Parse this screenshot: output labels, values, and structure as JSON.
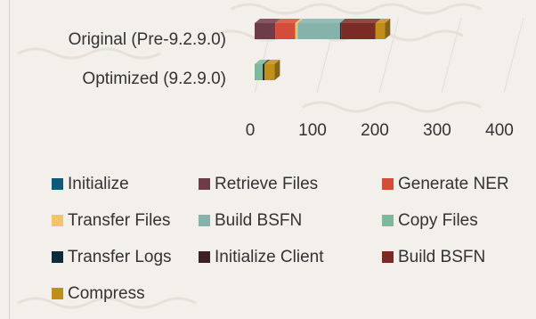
{
  "chart_data": {
    "type": "bar",
    "orientation": "horizontal",
    "stacked": true,
    "style": "3d",
    "categories": [
      "Original (Pre-9.2.9.0)",
      "Optimized (9.2.9.0)"
    ],
    "xlim": [
      0,
      400
    ],
    "xticks": [
      0,
      100,
      200,
      300,
      400
    ],
    "grid": false,
    "legend_position": "bottom",
    "series": [
      {
        "name": "Initialize",
        "color": "#0e5a78",
        "values": [
          0,
          0
        ]
      },
      {
        "name": "Retrieve Files",
        "color": "#6e3b49",
        "values": [
          33,
          0
        ]
      },
      {
        "name": "Generate NER",
        "color": "#d54c3a",
        "values": [
          32,
          0
        ]
      },
      {
        "name": "Transfer Files",
        "color": "#f2c46a",
        "values": [
          4,
          0
        ]
      },
      {
        "name": "Build BSFN",
        "color": "#86b2ac",
        "values": [
          68,
          0
        ]
      },
      {
        "name": "Copy Files",
        "color": "#7fb79a",
        "values": [
          0,
          13
        ]
      },
      {
        "name": "Transfer Logs",
        "color": "#0c2c3b",
        "values": [
          2,
          3
        ]
      },
      {
        "name": "Initialize Client",
        "color": "#3d1f26",
        "values": [
          0,
          0
        ]
      },
      {
        "name": "Build BSFN",
        "color": "#7a2b25",
        "values": [
          55,
          0
        ]
      },
      {
        "name": "Compress",
        "color": "#c28e1a",
        "values": [
          15,
          16
        ]
      }
    ]
  }
}
